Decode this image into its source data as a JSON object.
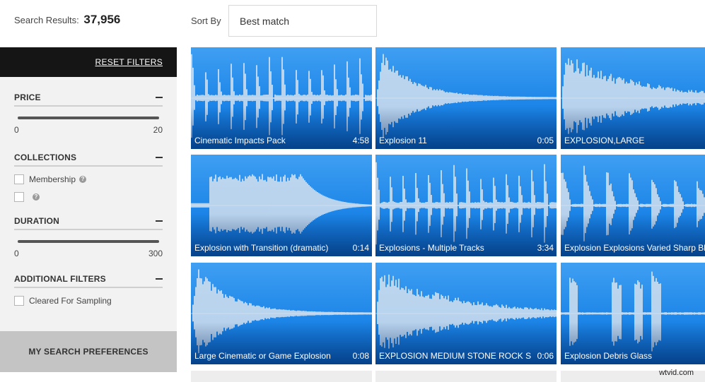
{
  "header": {
    "results_label": "Search Results:",
    "results_count": "37,956",
    "sort_label": "Sort By",
    "sort_value": "Best match"
  },
  "sidebar": {
    "reset_label": "RESET FILTERS",
    "price": {
      "title": "PRICE",
      "min": "0",
      "max": "20"
    },
    "collections": {
      "title": "COLLECTIONS",
      "items": [
        {
          "label": "Membership",
          "checked": false
        },
        {
          "label": "",
          "checked": false
        }
      ]
    },
    "duration": {
      "title": "DURATION",
      "min": "0",
      "max": "300"
    },
    "additional": {
      "title": "ADDITIONAL FILTERS",
      "items": [
        {
          "label": "Cleared For Sampling",
          "checked": false
        }
      ]
    },
    "preferences_label": "MY SEARCH PREFERENCES"
  },
  "results": [
    {
      "title": "Cinematic Impacts Pack",
      "duration": "4:58",
      "wave": "impacts"
    },
    {
      "title": "Explosion 11",
      "duration": "0:05",
      "wave": "burst"
    },
    {
      "title": "EXPLOSION,LARGE",
      "duration": "",
      "wave": "long"
    },
    {
      "title": "Explosion with Transition (dramatic)",
      "duration": "0:14",
      "wave": "swell"
    },
    {
      "title": "Explosions - Multiple Tracks",
      "duration": "3:34",
      "wave": "impacts"
    },
    {
      "title": "Explosion Explosions Varied Sharp Bl",
      "duration": "",
      "wave": "varied"
    },
    {
      "title": "Large Cinematic or Game Explosion",
      "duration": "0:08",
      "wave": "burst"
    },
    {
      "title": "EXPLOSION MEDIUM STONE ROCK S...",
      "duration": "0:06",
      "wave": "long"
    },
    {
      "title": "Explosion Debris Glass",
      "duration": "",
      "wave": "debris"
    }
  ],
  "watermark": "wtvid.com",
  "colors": {
    "card_blue": "#1d86e8",
    "wave": "#dfe6ee",
    "sidebar_bg": "#f2f2f2",
    "reset_bar": "#151515"
  }
}
